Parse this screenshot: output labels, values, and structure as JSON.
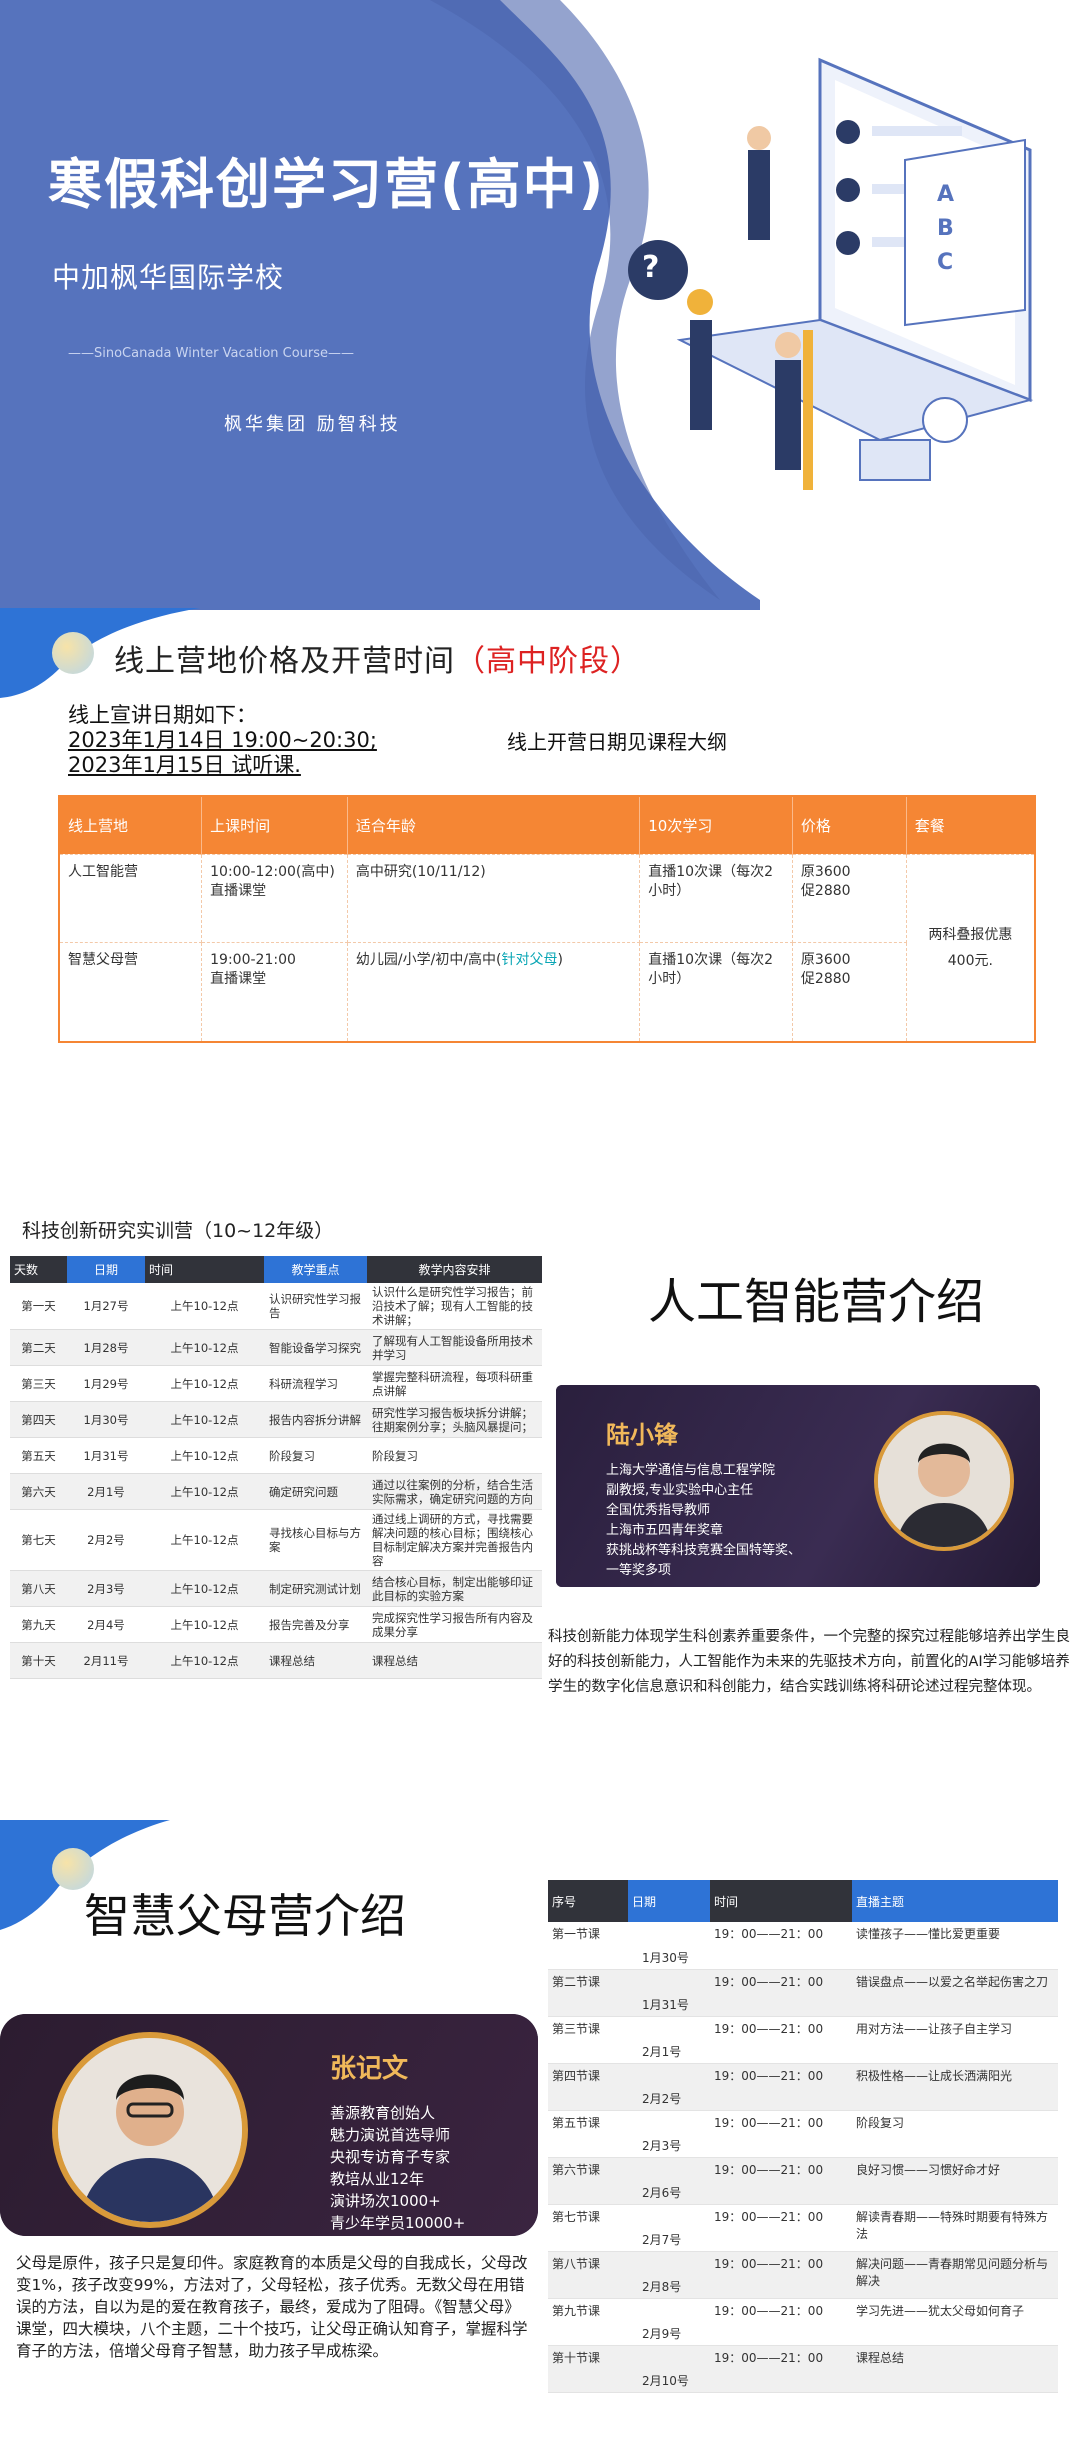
{
  "hero": {
    "title": "寒假科创学习营(高中)",
    "school": "中加枫华国际学校",
    "english": "——SinoCanada Winter Vacation Course——",
    "org": "枫华集团 励智科技",
    "brand_color": "#5673bd",
    "laptop_letters": [
      "A",
      "B",
      "C"
    ]
  },
  "pricing": {
    "heading": "线上营地价格及开营时间",
    "heading_highlight": "（高中阶段）",
    "lead_intro": "线上宣讲日期如下：",
    "lead_line1": "2023年1月14日 19:00~20:30;",
    "lead_line2": "2023年1月15日 试听课.",
    "lead_right": "线上开营日期见课程大纲",
    "headers": [
      "线上营地",
      "上课时间",
      "适合年龄",
      "10次学习",
      "价格",
      "套餐"
    ],
    "rows": [
      {
        "camp": "人工智能营",
        "time1": "10:00-12:00(高中)",
        "time2": "直播课堂",
        "age": "高中研究(10/11/12)",
        "age_highlight": "",
        "study": "直播10次课（每次2小时）",
        "price1": "原3600",
        "price2": "促2880"
      },
      {
        "camp": "智慧父母营",
        "time1": "19:00-21:00",
        "time2": "直播课堂",
        "age": "幼儿园/小学/初中/高中(",
        "age_highlight": "针对父母",
        "age_end": ")",
        "study": "直播10次课（每次2小时）",
        "price1": "原3600",
        "price2": "促2880"
      }
    ],
    "package": "两科叠报优惠400元.",
    "accent_color": "#f58634"
  },
  "ai_camp": {
    "table_title": "科技创新研究实训营（10~12年级）",
    "headers": [
      "天数",
      "日期",
      "时间",
      "教学重点",
      "教学内容安排"
    ],
    "rows": [
      {
        "day": "第一天",
        "date": "1月27号",
        "time": "上午10-12点",
        "focus": "认识研究性学习报告",
        "content": "认识什么是研究性学习报告；前沿技术了解；现有人工智能的技术讲解；"
      },
      {
        "day": "第二天",
        "date": "1月28号",
        "time": "上午10-12点",
        "focus": "智能设备学习探究",
        "content": "了解现有人工智能设备所用技术并学习"
      },
      {
        "day": "第三天",
        "date": "1月29号",
        "time": "上午10-12点",
        "focus": "科研流程学习",
        "content": "掌握完整科研流程，每项科研重点讲解"
      },
      {
        "day": "第四天",
        "date": "1月30号",
        "time": "上午10-12点",
        "focus": "报告内容拆分讲解",
        "content": "研究性学习报告板块拆分讲解；往期案例分享；头脑风暴提问；"
      },
      {
        "day": "第五天",
        "date": "1月31号",
        "time": "上午10-12点",
        "focus": "阶段复习",
        "content": "阶段复习"
      },
      {
        "day": "第六天",
        "date": "2月1号",
        "time": "上午10-12点",
        "focus": "确定研究问题",
        "content": "通过以往案例的分析，结合生活实际需求，确定研究问题的方向"
      },
      {
        "day": "第七天",
        "date": "2月2号",
        "time": "上午10-12点",
        "focus": "寻找核心目标与方案",
        "content": "通过线上调研的方式，寻找需要解决问题的核心目标；围绕核心目标制定解决方案并完善报告内容"
      },
      {
        "day": "第八天",
        "date": "2月3号",
        "time": "上午10-12点",
        "focus": "制定研究测试计划",
        "content": "结合核心目标，制定出能够印证此目标的实验方案"
      },
      {
        "day": "第九天",
        "date": "2月4号",
        "time": "上午10-12点",
        "focus": "报告完善及分享",
        "content": "完成探究性学习报告所有内容及成果分享"
      },
      {
        "day": "第十天",
        "date": "2月11号",
        "time": "上午10-12点",
        "focus": "课程总结",
        "content": "课程总结"
      }
    ],
    "intro_heading": "人工智能营介绍",
    "teacher_name": "陆小锋",
    "teacher_lines": [
      "上海大学通信与信息工程学院",
      "副教授,专业实验中心主任",
      "全国优秀指导教师",
      "上海市五四青年奖章",
      "获挑战杯等科技竞赛全国特等奖、",
      "一等奖多项"
    ],
    "description": "科技创新能力体现学生科创素养重要条件，一个完整的探究过程能够培养出学生良好的科技创新能力，人工智能作为未来的先驱技术方向，前置化的AI学习能够培养学生的数字化信息意识和科创能力，结合实践训练将科研论述过程完整体现。"
  },
  "parent_camp": {
    "intro_heading": "智慧父母营介绍",
    "teacher_name": "张记文",
    "teacher_lines": [
      "善源教育创始人",
      "魅力演说首选导师",
      "央视专访育子专家",
      "教培从业12年",
      "演讲场次1000+",
      "青少年学员10000+"
    ],
    "description": "父母是原件，孩子只是复印件。家庭教育的本质是父母的自我成长，父母改变1%，孩子改变99%，方法对了，父母轻松，孩子优秀。无数父母在用错误的方法，自以为是的爱在教育孩子，最终，爱成为了阻碍。《智慧父母》课堂，四大模块，八个主题，二十个技巧，让父母正确认知育子，掌握科学育子的方法，倍增父母育子智慧，助力孩子早成栋梁。",
    "headers": [
      "序号",
      "日期",
      "时间",
      "直播主题"
    ],
    "rows": [
      {
        "no": "第一节课",
        "date": "1月30号",
        "time": "19：00——21：00",
        "topic": "读懂孩子——懂比爱更重要"
      },
      {
        "no": "第二节课",
        "date": "1月31号",
        "time": "19：00——21：00",
        "topic": "错误盘点——以爱之名举起伤害之刀"
      },
      {
        "no": "第三节课",
        "date": "2月1号",
        "time": "19：00——21：00",
        "topic": "用对方法——让孩子自主学习"
      },
      {
        "no": "第四节课",
        "date": "2月2号",
        "time": "19：00——21：00",
        "topic": "积极性格——让成长洒满阳光"
      },
      {
        "no": "第五节课",
        "date": "2月3号",
        "time": "19：00——21：00",
        "topic": "阶段复习"
      },
      {
        "no": "第六节课",
        "date": "2月6号",
        "time": "19：00——21：00",
        "topic": "良好习惯——习惯好命才好"
      },
      {
        "no": "第七节课",
        "date": "2月7号",
        "time": "19：00——21：00",
        "topic": "解读青春期——特殊时期要有特殊方法"
      },
      {
        "no": "第八节课",
        "date": "2月8号",
        "time": "19：00——21：00",
        "topic": "解决问题——青春期常见问题分析与解决"
      },
      {
        "no": "第九节课",
        "date": "2月9号",
        "time": "19：00——21：00",
        "topic": "学习先进——犹太父母如何育子"
      },
      {
        "no": "第十节课",
        "date": "2月10号",
        "time": "19：00——21：00",
        "topic": "课程总结"
      }
    ]
  }
}
